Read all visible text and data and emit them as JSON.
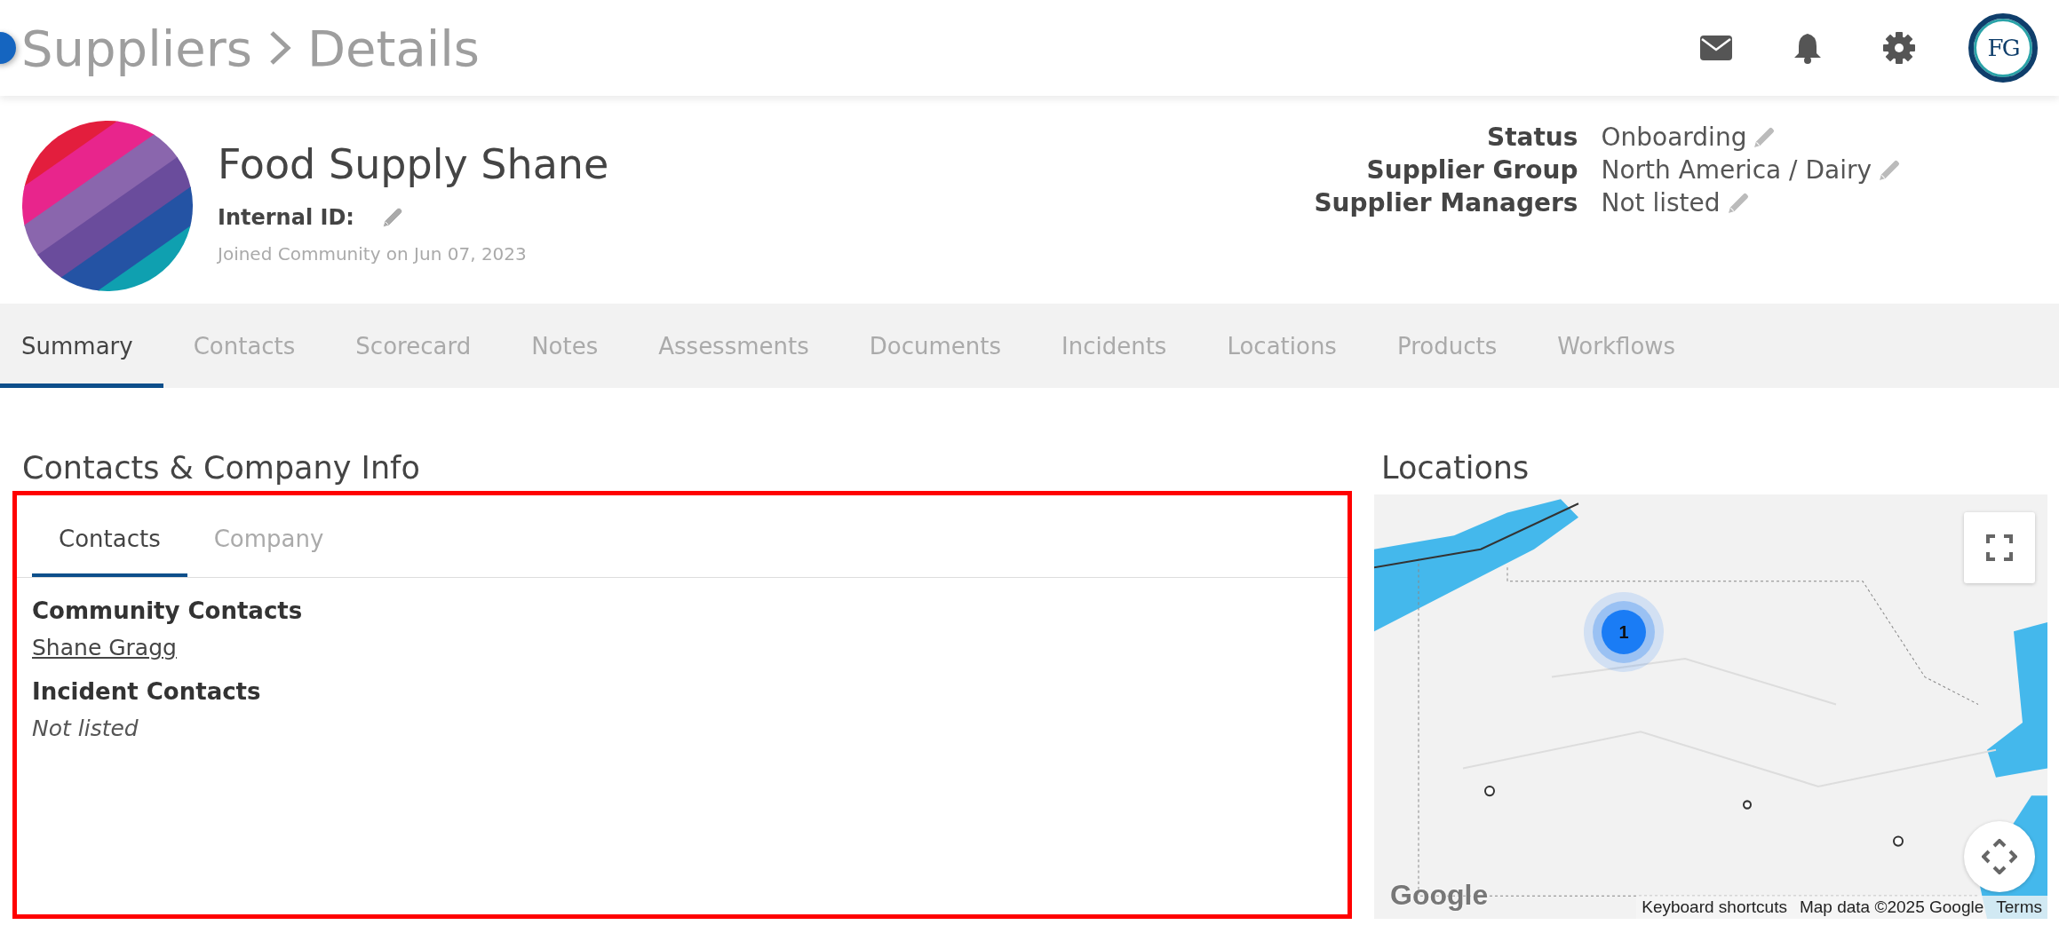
{
  "header": {
    "breadcrumb": [
      {
        "label": "Suppliers"
      },
      {
        "label": "Details"
      }
    ],
    "org_logo": "FG"
  },
  "supplier": {
    "name": "Food Supply Shane",
    "internal_id_label": "Internal ID:",
    "joined": "Joined Community on Jun 07, 2023"
  },
  "properties": [
    {
      "label": "Status",
      "value": "Onboarding"
    },
    {
      "label": "Supplier Group",
      "value": "North America / Dairy"
    },
    {
      "label": "Supplier Managers",
      "value": "Not listed"
    }
  ],
  "tabs": [
    {
      "label": "Summary",
      "selected": true
    },
    {
      "label": "Contacts",
      "selected": false
    },
    {
      "label": "Scorecard",
      "selected": false
    },
    {
      "label": "Notes",
      "selected": false
    },
    {
      "label": "Assessments",
      "selected": false
    },
    {
      "label": "Documents",
      "selected": false
    },
    {
      "label": "Incidents",
      "selected": false
    },
    {
      "label": "Locations",
      "selected": false
    },
    {
      "label": "Products",
      "selected": false
    },
    {
      "label": "Workflows",
      "selected": false
    }
  ],
  "contacts_section": {
    "title": "Contacts & Company Info",
    "tabs": [
      {
        "label": "Contacts",
        "selected": true
      },
      {
        "label": "Company",
        "selected": false
      }
    ],
    "groups": [
      {
        "title": "Community Contacts",
        "items": [
          {
            "kind": "link",
            "text": "Shane Gragg"
          }
        ]
      },
      {
        "title": "Incident Contacts",
        "items": [
          {
            "kind": "empty",
            "text": "Not listed"
          }
        ]
      }
    ]
  },
  "locations": {
    "title": "Locations",
    "cluster_count": "1",
    "logo": "Google",
    "footer": [
      "Keyboard shortcuts",
      "Map data ©2025 Google",
      "Terms"
    ]
  }
}
